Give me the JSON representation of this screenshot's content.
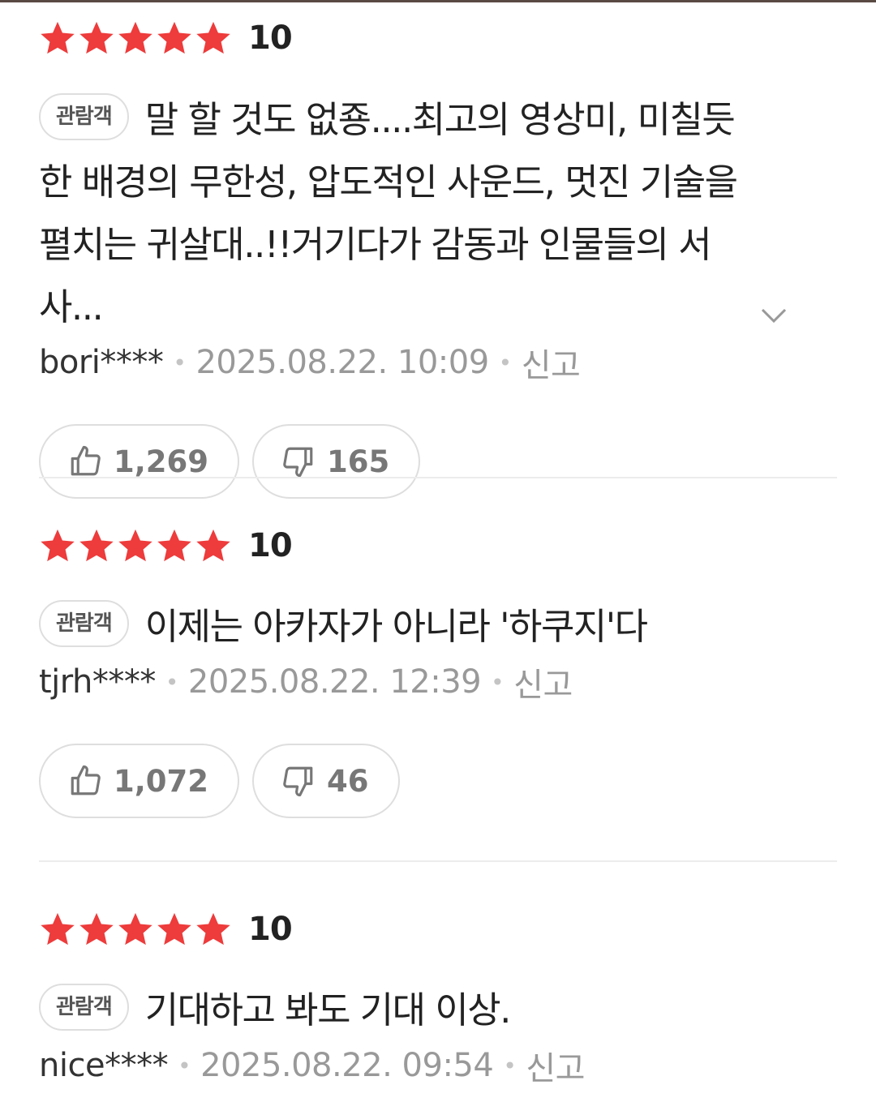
{
  "star_color": "#ee3b3b",
  "reviews": [
    {
      "rating": 5,
      "score": "10",
      "badge": "관람객",
      "text": "말 할 것도 없죵....최고의 영상미, 미칠듯한 배경의 무한성, 압도적인 사운드, 멋진 기술을 펼치는 귀살대..!!거기다가 감동과 인물들의 서사...",
      "expandable": true,
      "expand_icon": "chevron-down-icon",
      "user": "bori****",
      "date": "2025.08.22. 10:09",
      "report": "신고",
      "likes": "1,269",
      "dislikes": "165"
    },
    {
      "rating": 5,
      "score": "10",
      "badge": "관람객",
      "text": "이제는 아카자가 아니라 '하쿠지'다",
      "user": "tjrh****",
      "date": "2025.08.22. 12:39",
      "report": "신고",
      "likes": "1,072",
      "dislikes": "46"
    },
    {
      "rating": 5,
      "score": "10",
      "badge": "관람객",
      "text": "기대하고 봐도 기대 이상.",
      "user": "nice****",
      "date": "2025.08.22. 09:54",
      "report": "신고"
    }
  ]
}
